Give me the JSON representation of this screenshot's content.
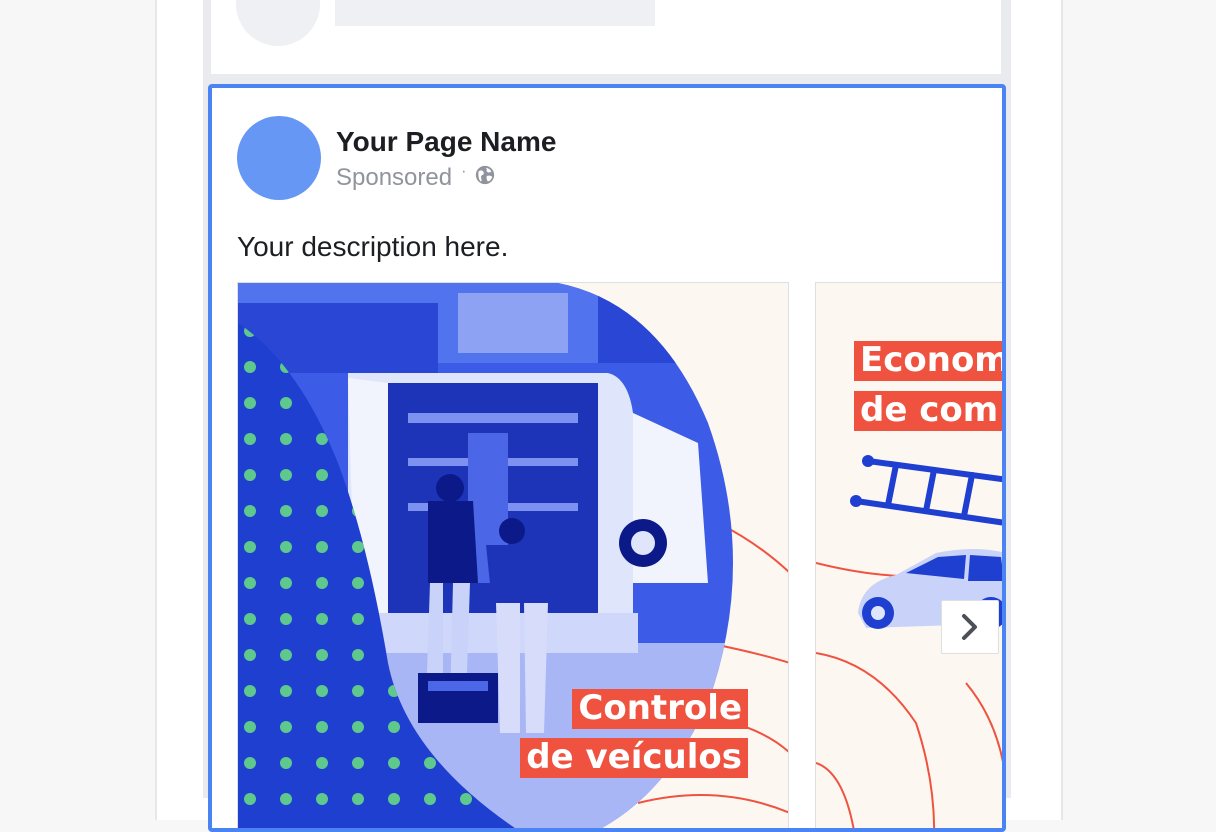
{
  "post": {
    "page_name": "Your Page Name",
    "sponsored_label": "Sponsored",
    "separator": "·",
    "privacy_icon": "globe-icon",
    "description": "Your description here."
  },
  "carousel": {
    "cards": [
      {
        "caption_line1": "Controle",
        "caption_line2": "de veículos"
      },
      {
        "caption_line1": "Econom",
        "caption_line2": "de com"
      }
    ],
    "next_icon": "chevron-right-icon"
  },
  "colors": {
    "accent_blue": "#4a84f4",
    "avatar_blue": "#6697f5",
    "brand_blue": "#1e3fd0",
    "dot_green": "#5ec88d",
    "caption_red": "#ef5340",
    "cream": "#fcf7f1"
  }
}
